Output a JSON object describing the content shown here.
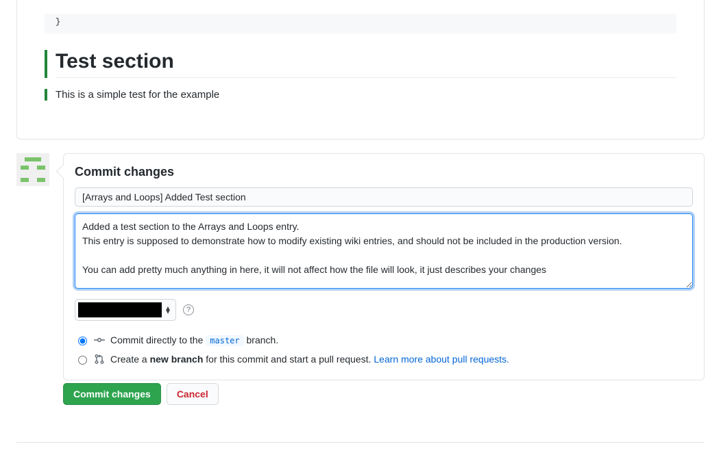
{
  "preview": {
    "code_stub": "}",
    "heading": "Test section",
    "text": "This is a simple test for the example"
  },
  "commit": {
    "title": "Commit changes",
    "summary_value": "[Arrays and Loops] Added Test section",
    "description_value": "Added a test section to the Arrays and Loops entry.\nThis entry is supposed to demonstrate how to modify existing wiki entries, and should not be included in the production version.\n\nYou can add pretty much anything in here, it will not affect how the file will look, it just describes your changes",
    "help_glyph": "?",
    "radio": {
      "direct_prefix": "Commit directly to the ",
      "direct_branch": "master",
      "direct_suffix": " branch.",
      "new_prefix": "Create a ",
      "new_bold": "new branch",
      "new_suffix": " for this commit and start a pull request. ",
      "learn_more": "Learn more about pull requests."
    }
  },
  "buttons": {
    "commit": "Commit changes",
    "cancel": "Cancel"
  }
}
